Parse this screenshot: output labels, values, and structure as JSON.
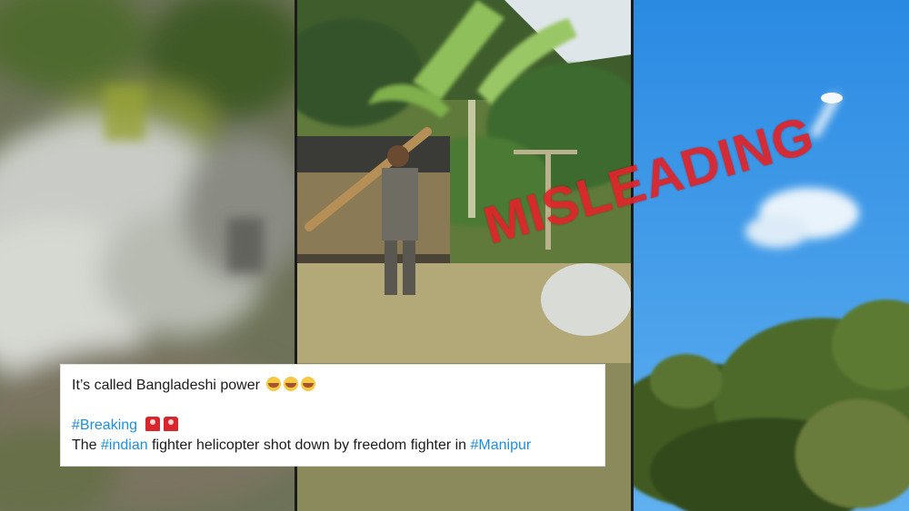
{
  "stamp": {
    "text": "MISLEADING",
    "color": "#e0242a"
  },
  "tweet": {
    "line1": "It’s called Bangladeshi power",
    "line1_emoji": [
      "face-with-tears-of-joy",
      "face-with-tears-of-joy",
      "face-with-tears-of-joy"
    ],
    "hashtag_breaking": "#Breaking",
    "breaking_emoji": [
      "police-light",
      "police-light"
    ],
    "line3_pre": "The",
    "hashtag_indian": "#indian",
    "line3_mid": "fighter helicopter shot down by freedom fighter in",
    "hashtag_manipur": "#Manipur",
    "link_color": "#1d8fe0"
  },
  "panels": [
    {
      "scene": "blurred smoke and vegetation"
    },
    {
      "scene": "man with launcher tube beside banana tree and truck"
    },
    {
      "scene": "blue sky with smoke trail above trees"
    }
  ]
}
